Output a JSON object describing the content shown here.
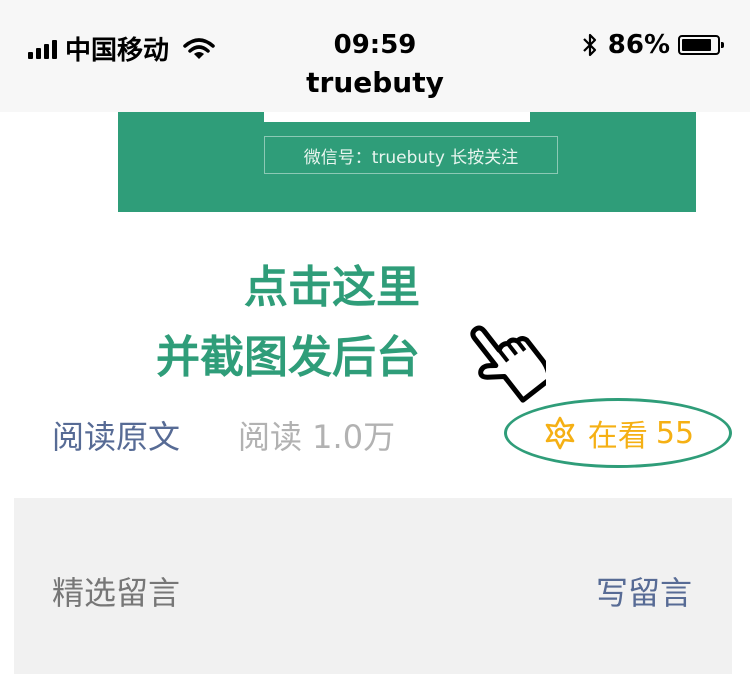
{
  "status_bar": {
    "carrier": "中国移动",
    "time": "09:59",
    "battery": "86%",
    "battery_level": 0.86,
    "icons": [
      "signal-icon",
      "wifi-icon",
      "bluetooth-icon",
      "battery-icon"
    ]
  },
  "nav": {
    "title": "truebuty"
  },
  "banner": {
    "wechat_id_text": "微信号：truebuty 长按关注"
  },
  "annotation": {
    "line1": "点击这里",
    "line2": "并截图发后台",
    "icon": "pointing-hand-icon"
  },
  "article_footer": {
    "read_original": "阅读原文",
    "read_count": "阅读 1.0万",
    "watching": {
      "icon": "watching-icon",
      "label": "在看",
      "count": "55"
    }
  },
  "comments": {
    "selected_label": "精选留言",
    "write_label": "写留言"
  },
  "colors": {
    "accent_green": "#2f9d79",
    "link_blue": "#576b95",
    "watching_yellow": "#f5b014",
    "muted_gray": "#b2b2b2"
  }
}
